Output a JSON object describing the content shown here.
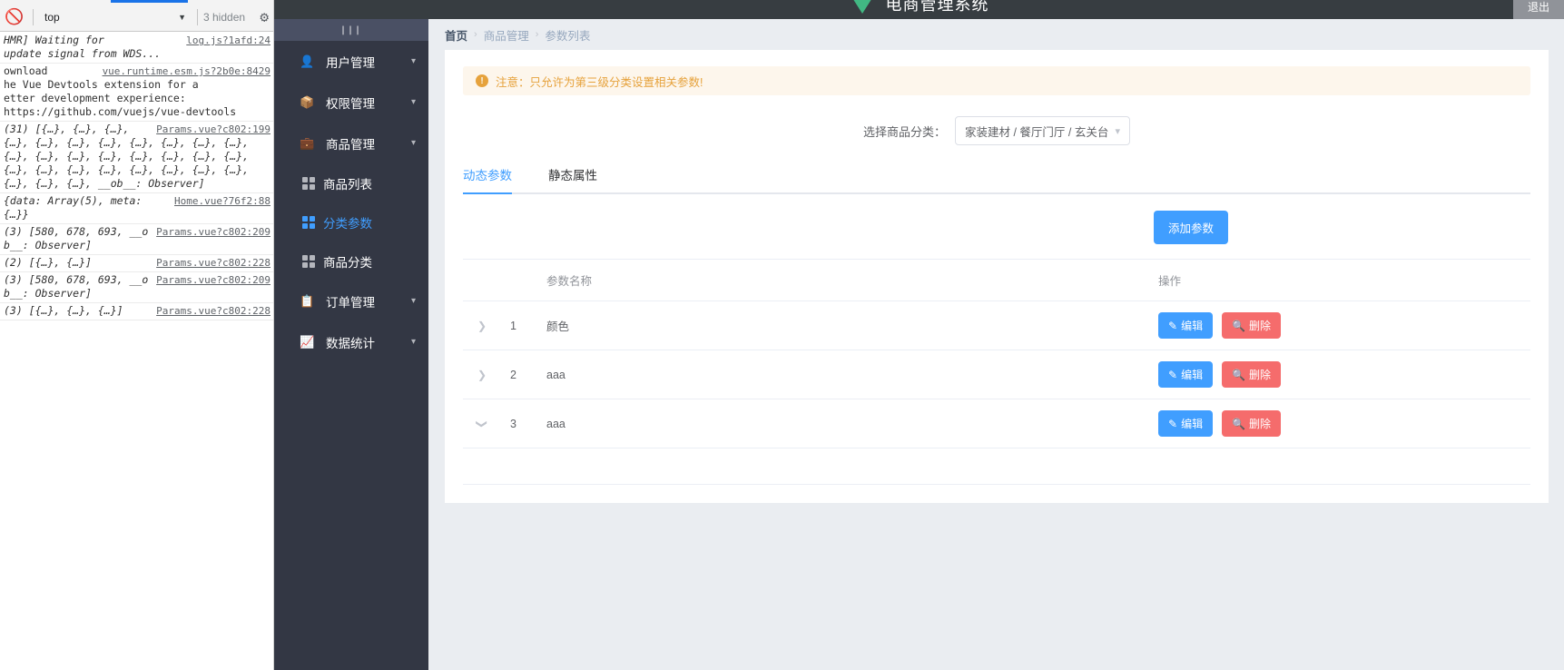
{
  "devtools": {
    "clear_icon": "no-entry-icon",
    "context": "top",
    "caret": "▼",
    "hidden_label": "3 hidden",
    "gear_icon": "gear-icon",
    "messages": [
      {
        "source": "log.js?1afd:24",
        "text": "HMR] Waiting for\nupdate signal from WDS...",
        "italic": true
      },
      {
        "source": "vue.runtime.esm.js?2b0e:8429",
        "text": "ownload \nhe Vue Devtools extension for a \netter development experience:\nhttps://github.com/vuejs/vue-devtools",
        "italic": false
      },
      {
        "source": "Params.vue?c802:199",
        "text": "(31) [{…}, {…}, {…}, {…}, {…}, {…}, {…}, {…}, {…}, {…}, {…}, {…}, {…}, {…}, {…}, {…}, {…}, {…}, {…}, {…}, {…}, {…}, {…}, {…}, {…}, {…}, {…}, {…}, {…}, {…}, __ob__: Observer]",
        "italic": true
      },
      {
        "source": "Home.vue?76f2:88",
        "text": "{data: Array(5), meta: {…}}",
        "italic": true
      },
      {
        "source": "Params.vue?c802:209",
        "text": "(3) [580, 678, 693, __ob__: Observer]",
        "italic": true
      },
      {
        "source": "Params.vue?c802:228",
        "text": "(2) [{…}, {…}]",
        "italic": true
      },
      {
        "source": "Params.vue?c802:209",
        "text": "(3) [580, 678, 693, __ob__: Observer]",
        "italic": true
      },
      {
        "source": "Params.vue?c802:228",
        "text": "(3) [{…}, {…}, {…}]",
        "italic": true
      }
    ]
  },
  "header": {
    "title": "电商管理系统",
    "logo_icon": "vue-triangle-logo",
    "logout_label": "退出"
  },
  "sidebar": {
    "toggle_label": "|||",
    "groups": [
      {
        "label": "用户管理",
        "icon": "user-icon",
        "chevron": "chevron-down-icon",
        "children": []
      },
      {
        "label": "权限管理",
        "icon": "box-icon",
        "chevron": "chevron-down-icon",
        "children": []
      },
      {
        "label": "商品管理",
        "icon": "bag-icon",
        "chevron": "chevron-up-icon",
        "children": [
          {
            "label": "商品列表",
            "icon": "grid-icon",
            "active": false
          },
          {
            "label": "分类参数",
            "icon": "grid-icon",
            "active": true
          },
          {
            "label": "商品分类",
            "icon": "grid-icon",
            "active": false
          }
        ]
      },
      {
        "label": "订单管理",
        "icon": "clipboard-icon",
        "chevron": "chevron-down-icon",
        "children": []
      },
      {
        "label": "数据统计",
        "icon": "chart-icon",
        "chevron": "chevron-down-icon",
        "children": []
      }
    ]
  },
  "breadcrumb": {
    "items": [
      "首页",
      "商品管理",
      "参数列表"
    ],
    "separator": "›"
  },
  "alert": {
    "icon": "warning-icon",
    "text": "注意：只允许为第三级分类设置相关参数!"
  },
  "category_select": {
    "label": "选择商品分类：",
    "value": "家装建材 / 餐厅门厅 / 玄关台",
    "arrow_icon": "chevron-down-icon"
  },
  "tabs": [
    {
      "label": "动态参数",
      "active": true
    },
    {
      "label": "静态属性",
      "active": false
    }
  ],
  "add_button": {
    "label": "添加参数"
  },
  "table": {
    "headers": [
      "",
      "",
      "参数名称",
      "操作"
    ],
    "rows": [
      {
        "expander": "chevron-right-icon",
        "expanded": false,
        "index": "1",
        "name": "颜色",
        "edit_label": "编辑",
        "delete_label": "删除",
        "edit_icon": "pencil-icon",
        "delete_icon": "search-delete-icon"
      },
      {
        "expander": "chevron-right-icon",
        "expanded": false,
        "index": "2",
        "name": "aaa",
        "edit_label": "编辑",
        "delete_label": "删除",
        "edit_icon": "pencil-icon",
        "delete_icon": "search-delete-icon"
      },
      {
        "expander": "chevron-down-icon",
        "expanded": true,
        "index": "3",
        "name": "aaa",
        "edit_label": "编辑",
        "delete_label": "删除",
        "edit_icon": "pencil-icon",
        "delete_icon": "search-delete-icon"
      }
    ]
  },
  "colors": {
    "primary": "#409eff",
    "danger": "#f56c6c",
    "warning": "#e6a23c",
    "sidebar": "#333744",
    "header": "#373d41",
    "page_bg": "#eaedf1"
  }
}
